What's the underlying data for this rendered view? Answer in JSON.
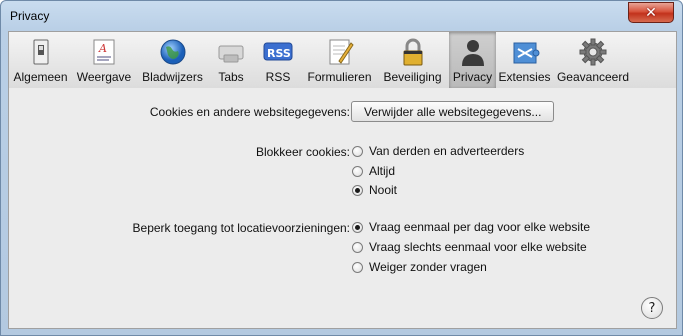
{
  "window": {
    "title": "Privacy",
    "close_glyph": "✕"
  },
  "toolbar": {
    "items": [
      {
        "label": "Algemeen",
        "icon": "switch-icon"
      },
      {
        "label": "Weergave",
        "icon": "font-icon"
      },
      {
        "label": "Bladwijzers",
        "icon": "globe-icon"
      },
      {
        "label": "Tabs",
        "icon": "tabs-icon"
      },
      {
        "label": "RSS",
        "icon": "rss-icon"
      },
      {
        "label": "Formulieren",
        "icon": "pencil-form-icon"
      },
      {
        "label": "Beveiliging",
        "icon": "lock-icon"
      },
      {
        "label": "Privacy",
        "icon": "person-silhouette-icon",
        "active": true
      },
      {
        "label": "Extensies",
        "icon": "puzzle-icon"
      },
      {
        "label": "Geavanceerd",
        "icon": "gear-icon"
      }
    ]
  },
  "cookies_row": {
    "label": "Cookies en andere websitegegevens:",
    "button": "Verwijder alle websitegegevens..."
  },
  "block_cookies": {
    "label": "Blokkeer cookies:",
    "options": [
      {
        "label": "Van derden en adverteerders",
        "checked": false
      },
      {
        "label": "Altijd",
        "checked": false
      },
      {
        "label": "Nooit",
        "checked": true
      }
    ]
  },
  "location": {
    "label": "Beperk toegang tot locatievoorzieningen:",
    "options": [
      {
        "label": "Vraag eenmaal per dag voor elke website",
        "checked": true
      },
      {
        "label": "Vraag slechts eenmaal voor elke website",
        "checked": false
      },
      {
        "label": "Weiger zonder vragen",
        "checked": false
      }
    ]
  },
  "help": {
    "glyph": "?"
  }
}
